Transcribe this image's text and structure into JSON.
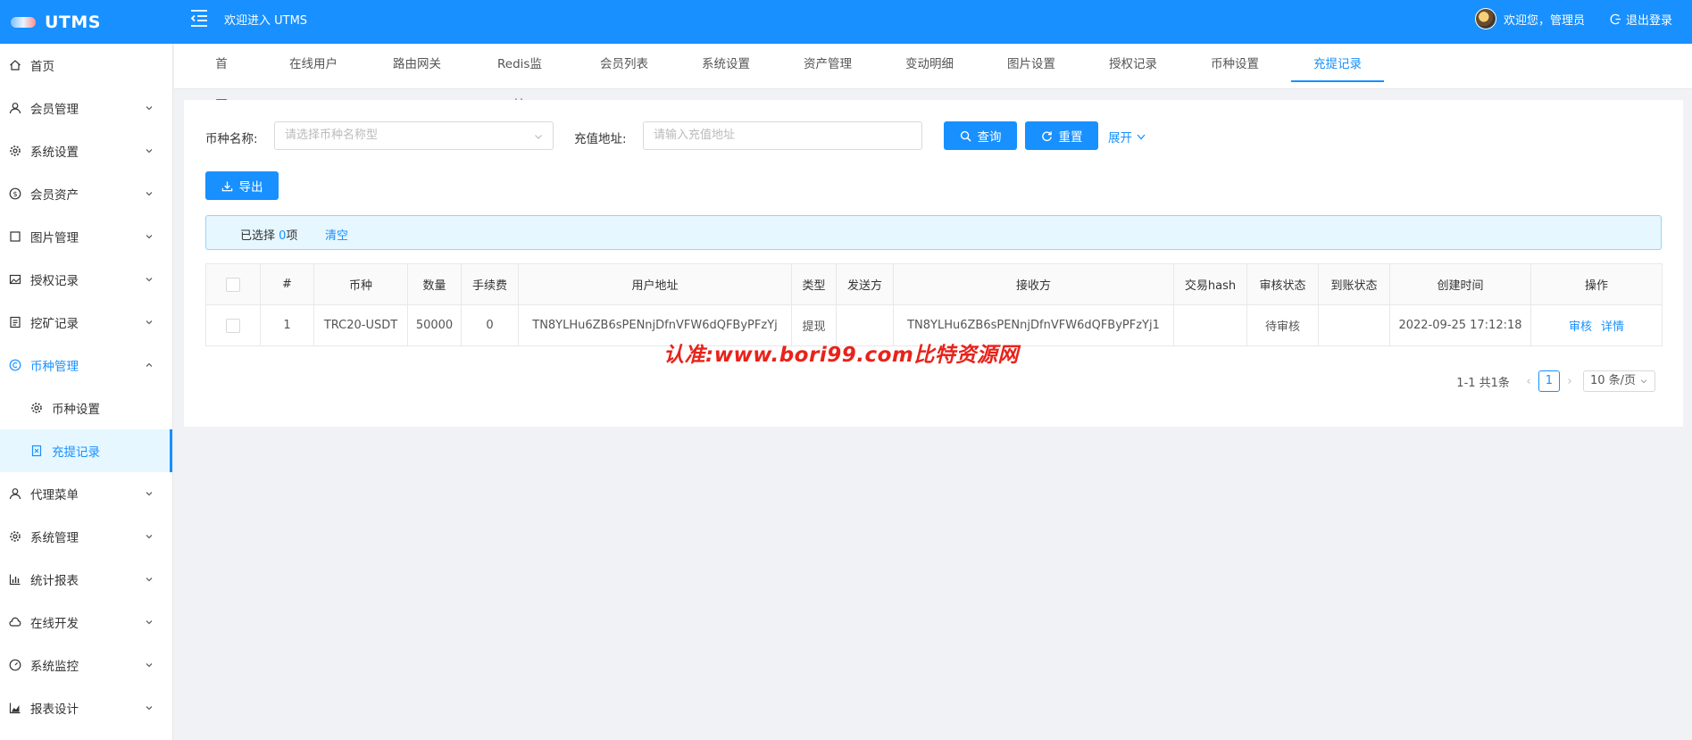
{
  "header": {
    "app_name": "UTMS",
    "welcome": "欢迎进入 UTMS",
    "user_greeting": "欢迎您，管理员",
    "logout": "退出登录"
  },
  "sidebar": {
    "items": [
      {
        "label": "首页",
        "icon": "home-icon"
      },
      {
        "label": "会员管理",
        "icon": "user-icon"
      },
      {
        "label": "系统设置",
        "icon": "gear-icon"
      },
      {
        "label": "会员资产",
        "icon": "dollar-icon"
      },
      {
        "label": "图片管理",
        "icon": "square-icon"
      },
      {
        "label": "授权记录",
        "icon": "image-icon"
      },
      {
        "label": "挖矿记录",
        "icon": "list-icon"
      },
      {
        "label": "币种管理",
        "icon": "copyright-icon"
      },
      {
        "label": "币种设置",
        "icon": "gear-icon"
      },
      {
        "label": "充提记录",
        "icon": "file-icon"
      },
      {
        "label": "代理菜单",
        "icon": "user-icon"
      },
      {
        "label": "系统管理",
        "icon": "gear-icon"
      },
      {
        "label": "统计报表",
        "icon": "bar-chart-icon"
      },
      {
        "label": "在线开发",
        "icon": "cloud-icon"
      },
      {
        "label": "系统监控",
        "icon": "dashboard-icon"
      },
      {
        "label": "报表设计",
        "icon": "area-chart-icon"
      }
    ]
  },
  "tabs": [
    "首页",
    "在线用户",
    "路由网关",
    "Redis监控",
    "会员列表",
    "系统设置",
    "资产管理",
    "变动明细",
    "图片设置",
    "授权记录",
    "币种设置",
    "充提记录"
  ],
  "search": {
    "coin_label": "币种名称:",
    "coin_placeholder": "请选择币种名称型",
    "address_label": "充值地址:",
    "address_placeholder": "请输入充值地址",
    "query": "查询",
    "reset": "重置",
    "expand": "展开"
  },
  "toolbar": {
    "export": "导出"
  },
  "selection": {
    "prefix": "已选择 ",
    "count": "0",
    "suffix": "项",
    "clear": "清空"
  },
  "table": {
    "headers": [
      "#",
      "币种",
      "数量",
      "手续费",
      "用户地址",
      "类型",
      "发送方",
      "接收方",
      "交易hash",
      "审核状态",
      "到账状态",
      "创建时间",
      "操作"
    ],
    "rows": [
      {
        "index": "1",
        "coin": "TRC20-USDT",
        "amount": "50000",
        "fee": "0",
        "user_address": "TN8YLHu6ZB6sPENnjDfnVFW6dQFByPFzYj",
        "type": "提现",
        "sender": "",
        "receiver": "TN8YLHu6ZB6sPENnjDfnVFW6dQFByPFzYj1",
        "tx_hash": "",
        "audit_status": "待审核",
        "arrival_status": "",
        "created": "2022-09-25 17:12:18",
        "op_audit": "审核",
        "op_detail": "详情"
      }
    ]
  },
  "pagination": {
    "total": "1-1 共1条",
    "current": "1",
    "page_size": "10 条/页"
  },
  "watermark": "认准:www.bori99.com比特资源网",
  "colors": {
    "primary": "#1890ff",
    "watermark": "#e8231a"
  }
}
